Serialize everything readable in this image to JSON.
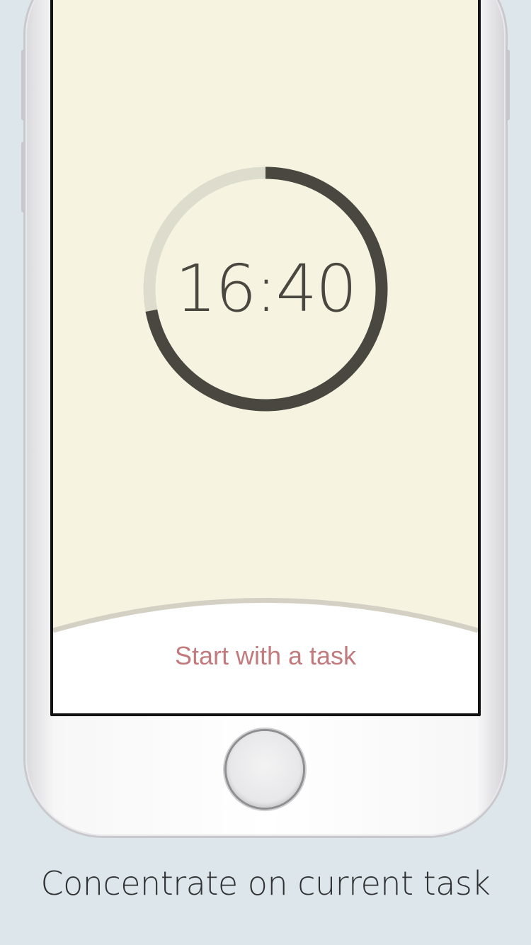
{
  "timer": {
    "time": "16:40",
    "progress_fraction": 0.72,
    "ring_color": "#4a4740",
    "track_color": "#dedccd"
  },
  "bottom_sheet": {
    "start_label": "Start with a task",
    "accent_color": "#c27a7c"
  },
  "caption": {
    "text": "Concentrate on current task"
  },
  "colors": {
    "background": "#dde6eb",
    "screen": "#f6f4e1"
  }
}
